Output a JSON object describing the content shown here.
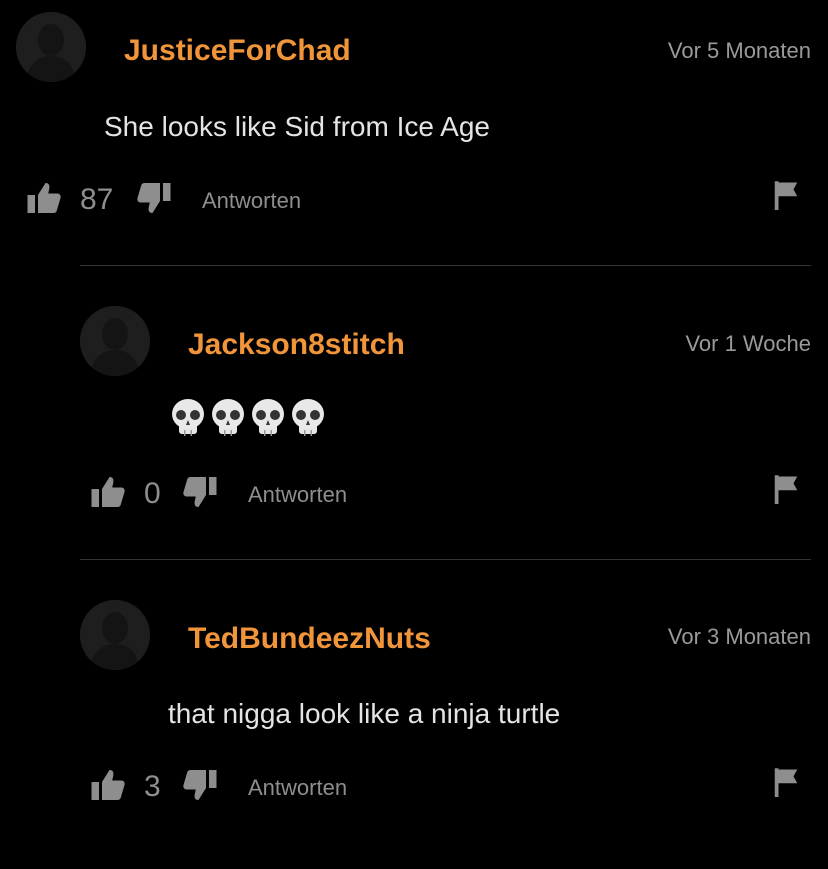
{
  "colors": {
    "background": "#000000",
    "username": "#f0953a",
    "timestamp": "#9a9a9a",
    "body_text": "#e4e4e4",
    "action": "#8e8e8e",
    "avatar_bg": "#1e1e1e"
  },
  "icons": {
    "avatar": "avatar-silhouette-icon",
    "like": "thumbs-up-icon",
    "dislike": "thumbs-down-icon",
    "report": "flag-icon",
    "emoji": "skull-emoji"
  },
  "comments": [
    {
      "username": "JusticeForChad",
      "timestamp": "Vor 5 Monaten",
      "text": "She looks like Sid from Ice Age",
      "likes": "87",
      "reply_label": "Antworten"
    },
    {
      "username": "Jackson8stitch",
      "timestamp": "Vor 1 Woche",
      "text": "💀💀💀💀",
      "likes": "0",
      "reply_label": "Antworten"
    },
    {
      "username": "TedBundeezNuts",
      "timestamp": "Vor 3 Monaten",
      "text": "that nigga look like a ninja turtle",
      "likes": "3",
      "reply_label": "Antworten"
    }
  ]
}
